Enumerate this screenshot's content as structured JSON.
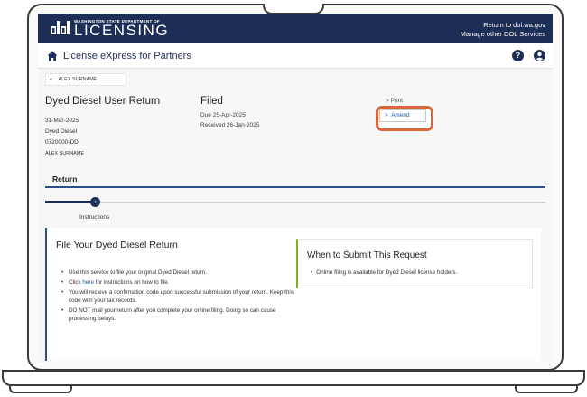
{
  "header": {
    "logo_small": "WASHINGTON STATE DEPARTMENT OF",
    "logo_big": "LICENSING",
    "link_return": "Return to dol.wa.gov",
    "link_manage": "Manage other DOL Services"
  },
  "nav": {
    "title": "License eXpress for Partners",
    "help_icon": "?"
  },
  "breadcrumb": {
    "label": "ALEX SURNAME"
  },
  "return_info": {
    "title": "Dyed Diesel User Return",
    "date": "31-Mar-2025",
    "type": "Dyed Diesel",
    "account": "0720000-DD",
    "name": "ALEX SURNAME"
  },
  "status": {
    "label": "Filed",
    "due": "Due 25-Apr-2025",
    "received": "Received 26-Jan-2025"
  },
  "actions": {
    "print": "Print",
    "amend": "Amend"
  },
  "tabs": {
    "return": "Return"
  },
  "stepper": {
    "step_label": "Instructions"
  },
  "main_card": {
    "title": "File Your Dyed Diesel Return",
    "bullet1": "Use this service to file your original Dyed Diesel return.",
    "bullet2_pre": "Click ",
    "bullet2_link": "here",
    "bullet2_post": " for instructions on how to file.",
    "bullet3": "You will recieve a confirmation code upon successful submission of your return. Keep this code with your tax records.",
    "bullet4": "DO NOT mail your return after you complete your online filing. Doing so can cause processing delays."
  },
  "side_card": {
    "title": "When to Submit This Request",
    "bullet": "Online filing is available for Dyed Diesel license holders."
  },
  "colors": {
    "header_bg": "#1e2f57",
    "accent_blue": "#2a4f87",
    "highlight_orange": "#d8683a",
    "green_accent": "#79b22a"
  }
}
